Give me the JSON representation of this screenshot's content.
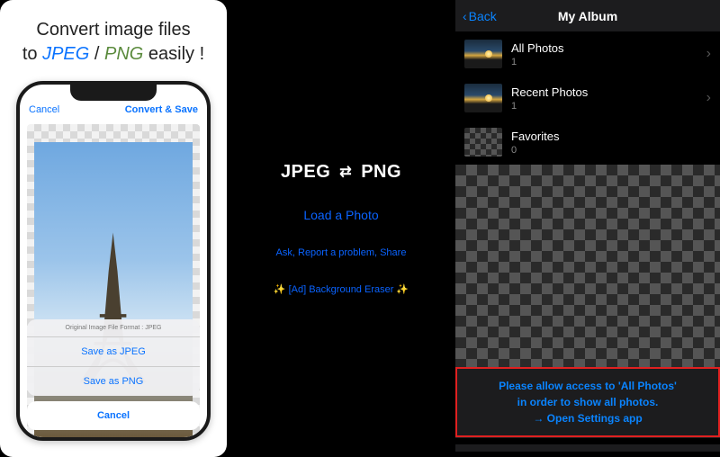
{
  "panel1": {
    "headline_pre": "Convert image files",
    "headline_to": "to",
    "headline_jpeg": "JPEG",
    "headline_sep": "/",
    "headline_png": "PNG",
    "headline_post": "easily !",
    "nav_cancel": "Cancel",
    "nav_convert": "Convert & Save",
    "sheet_caption": "Original Image File Format : JPEG",
    "save_jpeg": "Save as JPEG",
    "save_png": "Save as PNG",
    "cancel": "Cancel"
  },
  "panel2": {
    "title_left": "JPEG",
    "title_right": "PNG",
    "load": "Load a Photo",
    "ask": "Ask, Report a problem, Share",
    "ad": "✨ [Ad] Background Eraser ✨"
  },
  "panel3": {
    "back": "Back",
    "title": "My Album",
    "albums": [
      {
        "name": "All Photos",
        "count": "1"
      },
      {
        "name": "Recent Photos",
        "count": "1"
      },
      {
        "name": "Favorites",
        "count": "0"
      }
    ],
    "banner_l1": "Please allow access to 'All Photos'",
    "banner_l2": "in order to show all photos.",
    "banner_l3": "→ Open Settings app"
  }
}
